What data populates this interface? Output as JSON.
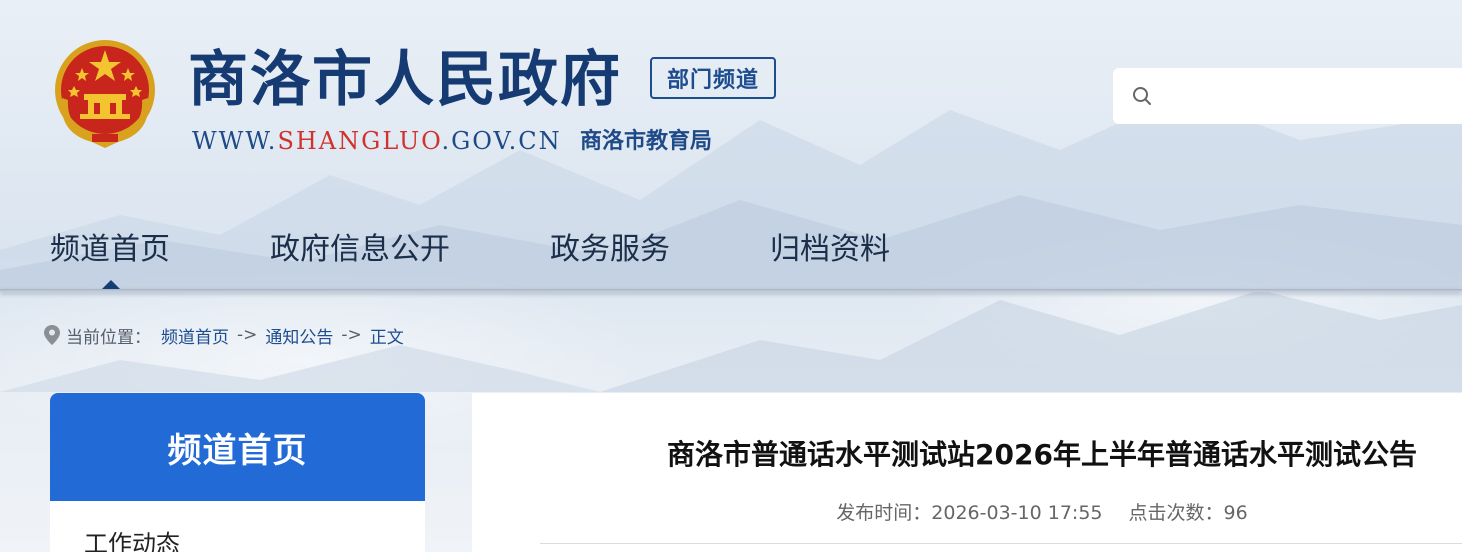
{
  "header": {
    "site_title": "商洛市人民政府",
    "channel_badge": "部门频道",
    "url_prefix": "WWW.",
    "url_domain": "SHANGLUO",
    "url_suffix": ".GOV.CN",
    "department": "商洛市教育局"
  },
  "search": {
    "placeholder": "",
    "icon": "search-icon"
  },
  "nav": {
    "items": [
      {
        "label": "频道首页",
        "active": true
      },
      {
        "label": "政府信息公开",
        "active": false
      },
      {
        "label": "政务服务",
        "active": false
      },
      {
        "label": "归档资料",
        "active": false
      }
    ]
  },
  "breadcrumb": {
    "prefix": "当前位置：",
    "items": [
      "频道首页",
      "通知公告",
      "正文"
    ],
    "separator": "->"
  },
  "sidebar": {
    "title": "频道首页",
    "items": [
      "工作动态"
    ]
  },
  "article": {
    "title": "商洛市普通话水平测试站2026年上半年普通话水平测试公告",
    "publish_label": "发布时间：",
    "publish_time": "2026-03-10 17:55",
    "clicks_label": "点击次数：",
    "clicks": "96"
  },
  "colors": {
    "brand_navy": "#163a72",
    "url_red": "#d0332d",
    "sidebar_blue": "#226bd6",
    "link_blue": "#1d4d8f"
  }
}
